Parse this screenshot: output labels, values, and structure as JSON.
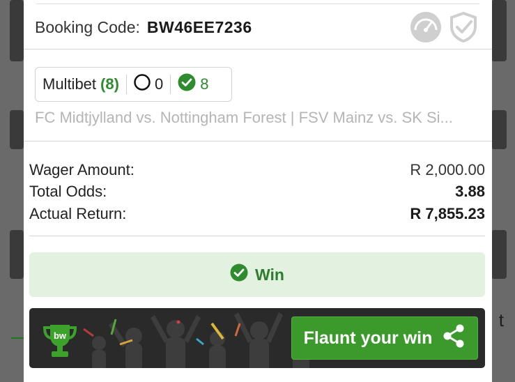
{
  "booking": {
    "label": "Booking Code:",
    "code": "BW46EE7236",
    "icons": [
      "speedometer-icon",
      "shield-check-icon"
    ]
  },
  "multibet": {
    "label": "Multibet",
    "count": "(8)",
    "pending": "0",
    "won": "8"
  },
  "matches": "FC Midtjylland vs. Nottingham Forest | FSV Mainz vs. SK Si...",
  "summary": {
    "wager_label": "Wager Amount:",
    "wager_value": "R 2,000.00",
    "odds_label": "Total Odds:",
    "odds_value": "3.88",
    "return_label": "Actual Return:",
    "return_value": "R 7,855.23"
  },
  "result": {
    "label": "Win",
    "color": "#2e7d2e"
  },
  "flaunt": {
    "logo_text": "bw",
    "button_label": "Flaunt your win",
    "button_color": "#3c9a2c"
  },
  "background": {
    "right_letter": "t"
  }
}
